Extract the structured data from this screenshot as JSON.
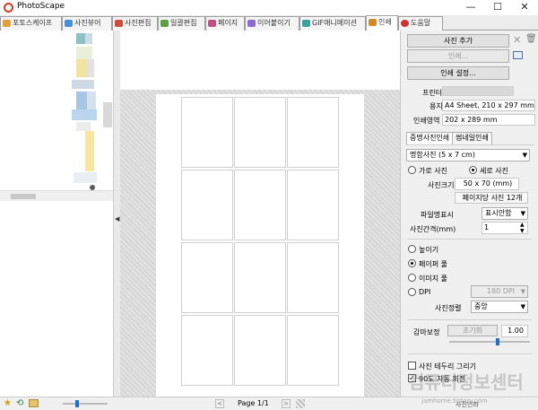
{
  "window": {
    "title": "PhotoScape",
    "minimize": "—",
    "maximize": "☐",
    "close": "✕"
  },
  "tabs": [
    {
      "label": "포토스케이프",
      "color": "#e0a03a"
    },
    {
      "label": "사진뷰어",
      "color": "#4a8fd6"
    },
    {
      "label": "사진편집",
      "color": "#d04c3c"
    },
    {
      "label": "일괄편집",
      "color": "#5aa04a"
    },
    {
      "label": "페이지",
      "color": "#c05080"
    },
    {
      "label": "이어붙이기",
      "color": "#8a6ad0"
    },
    {
      "label": "GIF애니메이션",
      "color": "#3aa0a0"
    },
    {
      "label": "인쇄",
      "color": "#d08a2a"
    },
    {
      "label": "도움말",
      "color": "#d23030"
    }
  ],
  "print_panel": {
    "add_photo": "사진 추가",
    "print_button": "인쇄...",
    "print_settings": "인쇄 설정...",
    "printer_label": "프린터",
    "paper_label": "용지",
    "paper_value": "A4 Sheet, 210 x 297 mm",
    "print_area_label": "인쇄영역",
    "print_area_value": "202 x 289 mm",
    "subtabs": [
      "증명사진인쇄",
      "썸네일인쇄"
    ],
    "size_select": "명함사진 (5 x 7 cm)",
    "orientation": {
      "landscape": "가로 사진",
      "portrait": "세로 사진",
      "selected": "portrait"
    },
    "photo_size_label": "사진크기",
    "photo_size_value": "50 x 70 (mm)",
    "per_page": "페이지당 사진 12개",
    "filename_label": "파일명표시",
    "filename_value": "표시안함",
    "spacing_label": "사진간격(mm)",
    "spacing_value": "1",
    "fit_options": {
      "height": "높이기",
      "paper_fill": "페이퍼 풀",
      "image_fill": "이미지 풀",
      "dpi": "DPI",
      "selected": "paper_fill"
    },
    "dpi_value": "180 DPI",
    "align_label": "사진정렬",
    "align_value": "중앙",
    "gamma_label": "감마보정",
    "gamma_reset": "초기화",
    "gamma_value": "1.00",
    "gamma_level": 0.6,
    "border_label": "사진 테두리 그리기",
    "rotate_label": "90도 자동 회전",
    "rotate_checked": true,
    "print_bottom": "사진인화"
  },
  "pager": {
    "prev": "<",
    "next": ">",
    "label": "Page 1/1"
  },
  "watermark": {
    "line1": "컴퓨터정보센터",
    "line2": "jamhome.tistory.com"
  }
}
